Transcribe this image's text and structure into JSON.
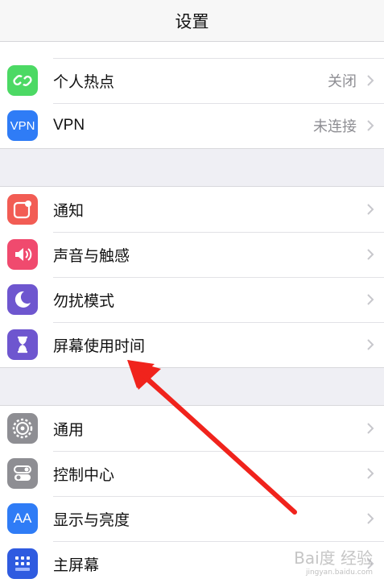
{
  "header": {
    "title": "设置"
  },
  "groups": [
    {
      "items": [
        {
          "label": "个人热点",
          "value": "关闭",
          "icon": "link-icon",
          "color": "#4cd964"
        },
        {
          "label": "VPN",
          "value": "未连接",
          "icon_text": "VPN",
          "icon": "vpn-icon",
          "color": "#2f7cf6"
        }
      ]
    },
    {
      "items": [
        {
          "label": "通知",
          "icon": "notification-icon",
          "color": "#f25c54"
        },
        {
          "label": "声音与触感",
          "icon": "speaker-icon",
          "color": "#f04a6e"
        },
        {
          "label": "勿扰模式",
          "icon": "moon-icon",
          "color": "#6e56cf"
        },
        {
          "label": "屏幕使用时间",
          "icon": "hourglass-icon",
          "color": "#6e56cf"
        }
      ]
    },
    {
      "items": [
        {
          "label": "通用",
          "icon": "gear-icon",
          "color": "#8e8e93"
        },
        {
          "label": "控制中心",
          "icon": "toggles-icon",
          "color": "#8e8e93"
        },
        {
          "label": "显示与亮度",
          "icon_text": "AA",
          "icon": "display-icon",
          "color": "#2f7cf6"
        },
        {
          "label": "主屏幕",
          "icon": "home-grid-icon",
          "color": "#2f5be0"
        }
      ]
    }
  ],
  "annotation": {
    "color": "#f0231c"
  },
  "watermark": {
    "text": "Bai度 经验",
    "sub": "jingyan.baidu.com"
  }
}
